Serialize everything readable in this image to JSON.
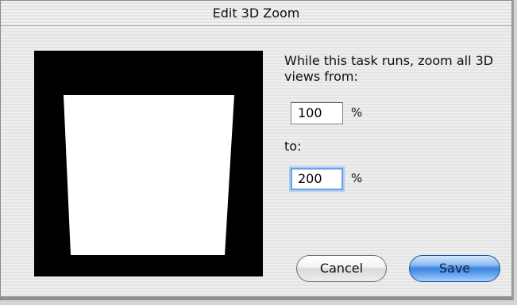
{
  "dialog": {
    "title": "Edit 3D Zoom",
    "prompt": "While this task runs, zoom all 3D views from:",
    "to_label": "to:",
    "from_value": "100",
    "to_value": "200",
    "percent_symbol": "%",
    "cancel_label": "Cancel",
    "save_label": "Save"
  },
  "preview": {
    "icon": "zoom-preview-icon",
    "background_color": "#000000",
    "shape_color": "#ffffff"
  },
  "colors": {
    "focus_ring": "#6ea1df",
    "primary_button": "#3c84e0"
  }
}
